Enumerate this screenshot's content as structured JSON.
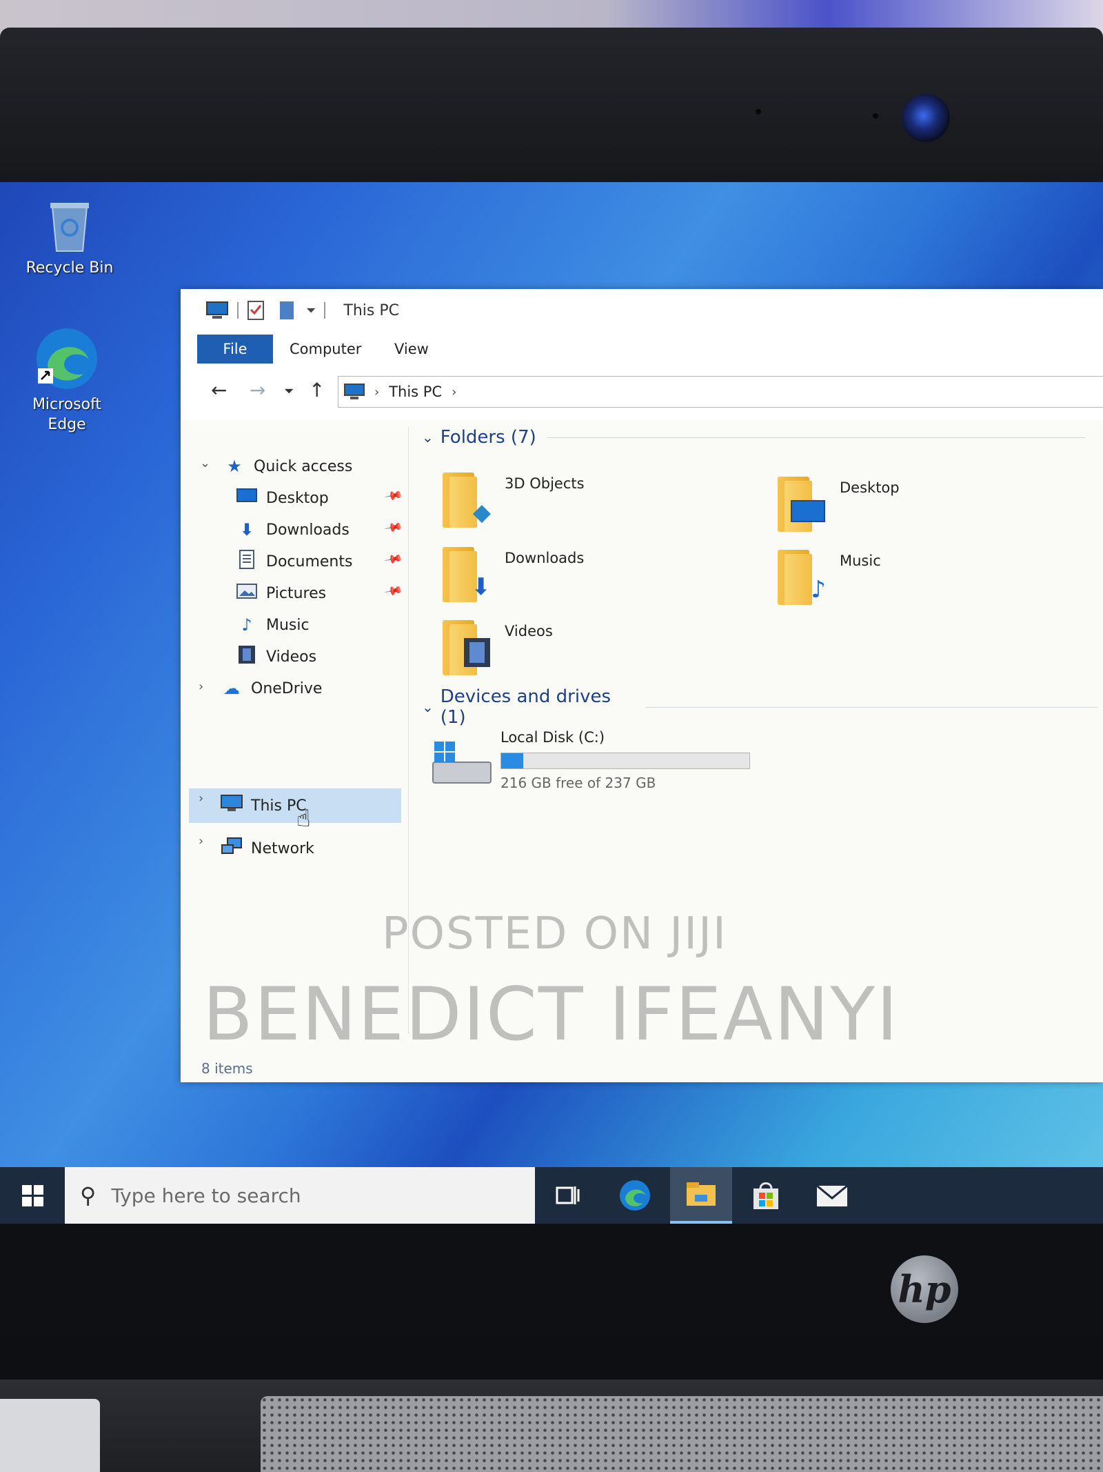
{
  "desktop": {
    "icons": [
      {
        "label": "Recycle Bin"
      },
      {
        "label": "Microsoft\nEdge"
      }
    ]
  },
  "window": {
    "title": "This PC",
    "ribbon_tabs": [
      "File",
      "Computer",
      "View"
    ],
    "address": {
      "root": "This PC"
    },
    "sidebar": {
      "quick_access": "Quick access",
      "items": [
        "Desktop",
        "Downloads",
        "Documents",
        "Pictures",
        "Music",
        "Videos"
      ],
      "onedrive": "OneDrive",
      "this_pc": "This PC",
      "network": "Network"
    },
    "folders_header": "Folders (7)",
    "folders": [
      "3D Objects",
      "Desktop",
      "Downloads",
      "Music",
      "Videos"
    ],
    "devices_header": "Devices and drives (1)",
    "drive": {
      "name": "Local Disk (C:)",
      "free_text": "216 GB free of 237 GB",
      "used_fraction": 0.09
    },
    "status": "8 items"
  },
  "watermark": {
    "line1": "POSTED ON JIJI",
    "line2": "BENEDICT IFEANYI"
  },
  "taskbar": {
    "search_placeholder": "Type here to search",
    "icons": [
      "task-view-icon",
      "edge-icon",
      "file-explorer-icon",
      "store-icon",
      "mail-icon"
    ]
  },
  "hardware": {
    "brand": "hp"
  },
  "colors": {
    "accent": "#1f5fb3",
    "selection": "#c8dff3",
    "drive_fill": "#2a8be3",
    "taskbar": "#1c2b3e"
  }
}
